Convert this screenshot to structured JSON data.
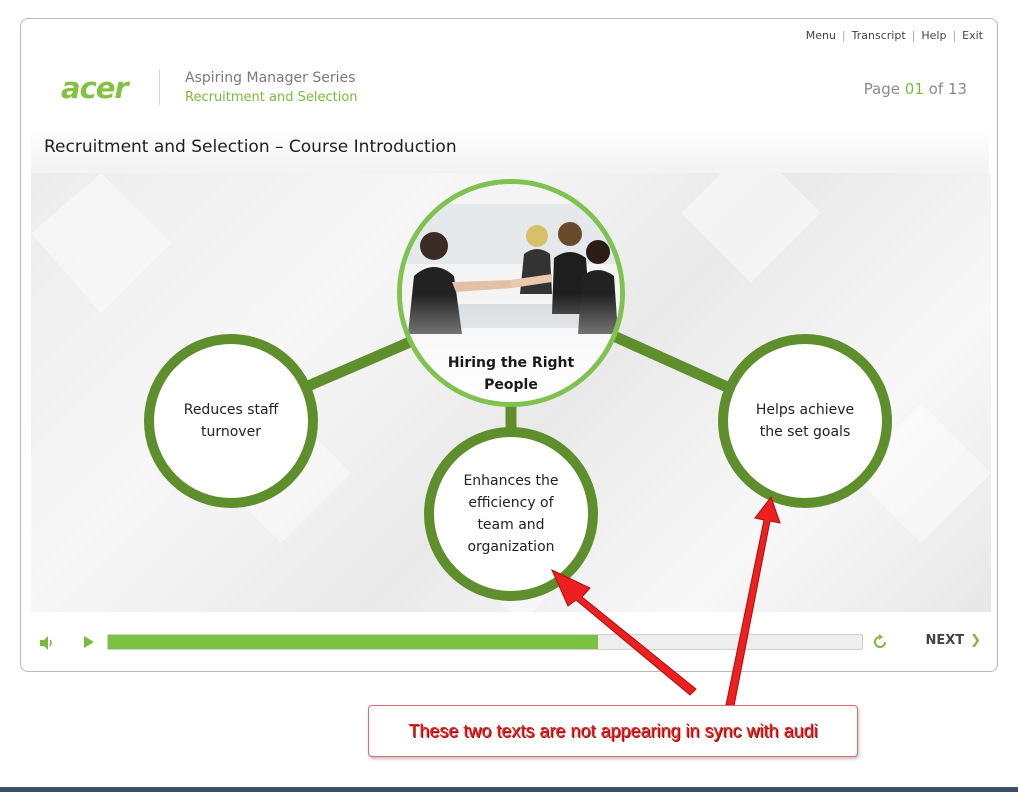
{
  "topnav": [
    "Menu",
    "Transcript",
    "Help",
    "Exit"
  ],
  "brand": {
    "logo_text": "acer"
  },
  "header": {
    "series": "Aspiring Manager Series",
    "subtitle": "Recruitment and Selection",
    "page_prefix": "Page",
    "page_current": "01",
    "page_of": "of 13"
  },
  "slide": {
    "title": "Recruitment and Selection – Course Introduction",
    "hub_line1": "Hiring the Right",
    "hub_line2": "People",
    "left_line1": "Reduces staff",
    "left_line2": "turnover",
    "center_line1": "Enhances the",
    "center_line2": "efficiency of",
    "center_line3": "team and",
    "center_line4": "organization",
    "right_line1": "Helps achieve",
    "right_line2": "the set goals",
    "hub_image_icon": "business-meeting-photo"
  },
  "controls": {
    "volume_icon": "speaker-icon",
    "play_icon": "play-icon",
    "replay_icon": "replay-icon",
    "progress_percent": 65,
    "next_label": "NEXT"
  },
  "annotation": {
    "callout_text": "These two texts are not appearing in sync with audi"
  },
  "colors": {
    "accent": "#7cb93a",
    "ring": "#5f8f2c",
    "hub_ring": "#7ec24f",
    "annotation_red": "#ef1b1b"
  }
}
